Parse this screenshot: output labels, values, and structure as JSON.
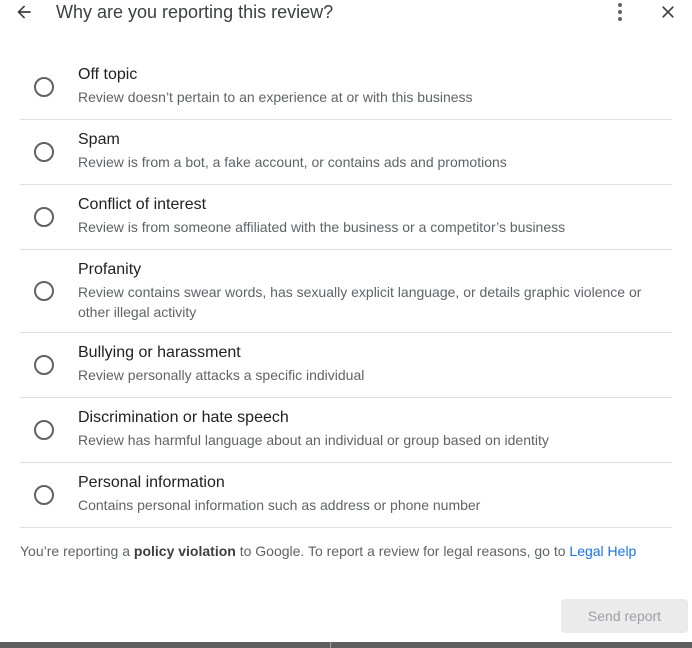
{
  "header": {
    "title": "Why are you reporting this review?",
    "back_icon": "arrow-back-icon",
    "more_icon": "more-vert-icon",
    "close_icon": "close-icon"
  },
  "options": [
    {
      "title": "Off topic",
      "description": "Review doesn’t pertain to an experience at or with this business"
    },
    {
      "title": "Spam",
      "description": "Review is from a bot, a fake account, or contains ads and promotions"
    },
    {
      "title": "Conflict of interest",
      "description": "Review is from someone affiliated with the business or a competitor’s business"
    },
    {
      "title": "Profanity",
      "description": "Review contains swear words, has sexually explicit language, or details graphic violence or other illegal activity"
    },
    {
      "title": "Bullying or harassment",
      "description": "Review personally attacks a specific individual"
    },
    {
      "title": "Discrimination or hate speech",
      "description": "Review has harmful language about an individual or group based on identity"
    },
    {
      "title": "Personal information",
      "description": "Contains personal information such as address or phone number"
    }
  ],
  "footnote": {
    "prefix": "You’re reporting a ",
    "bold": "policy violation",
    "middle": " to Google. To report a review for legal reasons, go to ",
    "link": "Legal Help"
  },
  "actions": {
    "send_label": "Send report"
  },
  "colors": {
    "link": "#1a73e8",
    "divider": "#e0e0e0",
    "disabled_button_bg": "#ebebeb"
  }
}
